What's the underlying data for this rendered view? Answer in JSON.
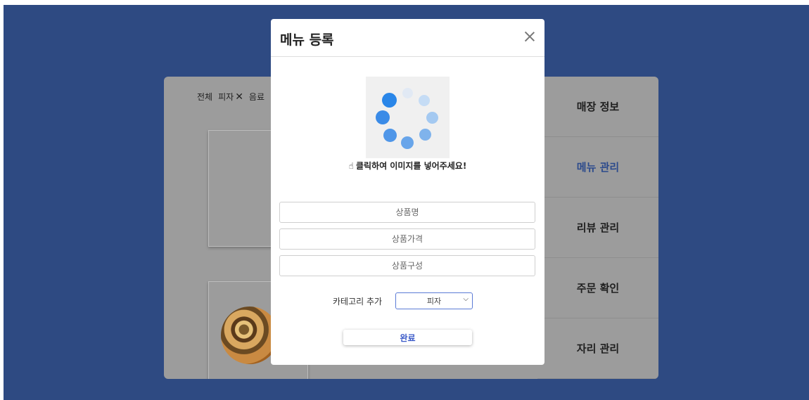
{
  "filters": [
    {
      "label": "전체"
    },
    {
      "label": "피자",
      "removable": true
    },
    {
      "label": "음료"
    }
  ],
  "sidebar": {
    "items": [
      {
        "label": "매장 정보"
      },
      {
        "label": "메뉴 관리",
        "active": true
      },
      {
        "label": "리뷰 관리"
      },
      {
        "label": "주문 확인"
      },
      {
        "label": "자리 관리"
      }
    ]
  },
  "modal": {
    "title": "메뉴 등록",
    "image_hint": "클릭하여 이미지를 넣어주세요!",
    "name_placeholder": "상품명",
    "price_placeholder": "상품가격",
    "composition_placeholder": "상품구성",
    "category_label": "카테고리 추가",
    "category_selected": "피자",
    "done_label": "완료"
  },
  "colors": {
    "background": "#2e4a82",
    "accent": "#3b5ac8",
    "spinner": "#2a86e8"
  },
  "icons": [
    "close-icon",
    "pointing-hand-icon",
    "loading-spinner-icon",
    "chevron-down-icon"
  ]
}
